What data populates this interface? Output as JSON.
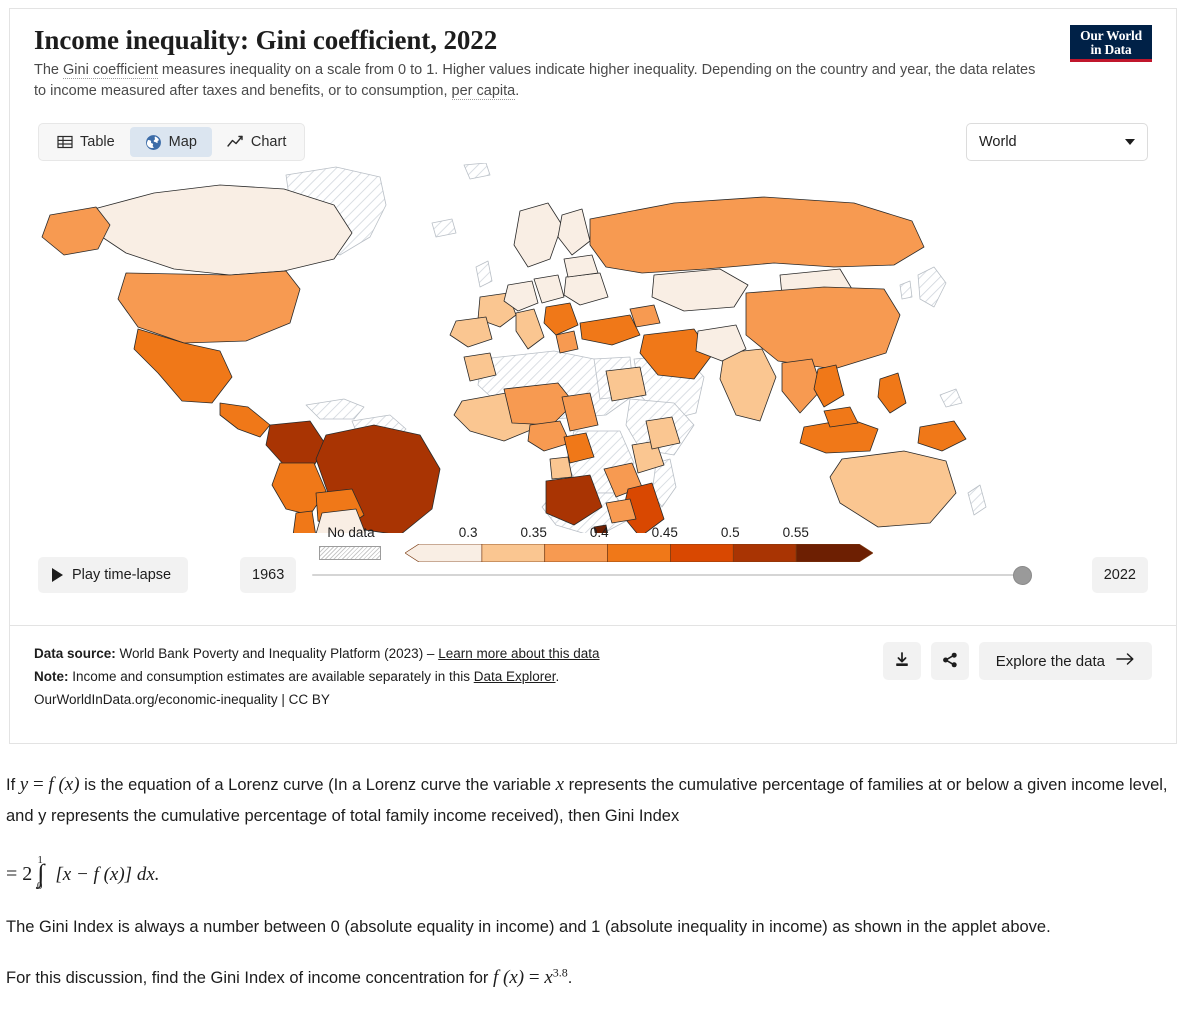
{
  "chart": {
    "title": "Income inequality: Gini coefficient, 2022",
    "subtitle_part1": "The ",
    "subtitle_link1": "Gini coefficient",
    "subtitle_part2": " measures inequality on a scale from 0 to 1. Higher values indicate higher inequality. Depending on the country and year, the data relates to income measured after taxes and benefits, or to consumption, ",
    "subtitle_link2": "per capita",
    "subtitle_part3": ".",
    "logo_line1": "Our World",
    "logo_line2": "in Data"
  },
  "tabs": [
    {
      "label": "Table",
      "icon": "table-icon",
      "active": false
    },
    {
      "label": "Map",
      "icon": "globe-icon",
      "active": true
    },
    {
      "label": "Chart",
      "icon": "line-chart-icon",
      "active": false
    }
  ],
  "entity_select": {
    "value": "World",
    "icon": "chevron-down-icon"
  },
  "legend": {
    "no_data_label": "No data",
    "tick_labels": [
      "0.3",
      "0.35",
      "0.4",
      "0.45",
      "0.5",
      "0.55"
    ],
    "colors": [
      "#f9eee4",
      "#fac691",
      "#f79a51",
      "#f07818",
      "#d94801",
      "#a93403",
      "#6d1f02"
    ]
  },
  "time_controls": {
    "play_label": "Play time-lapse",
    "play_icon": "play-icon",
    "start_year": "1963",
    "end_year": "2022"
  },
  "footer": {
    "source_label": "Data source:",
    "source_text": " World Bank Poverty and Inequality Platform (2023) – ",
    "source_link": "Learn more about this data",
    "note_label": "Note:",
    "note_text": " Income and consumption estimates are available separately in this ",
    "note_link": "Data Explorer",
    "note_tail": ".",
    "license": "OurWorldInData.org/economic-inequality | CC BY",
    "download_icon": "download-icon",
    "share_icon": "share-icon",
    "explore_label": "Explore the data",
    "explore_icon": "arrow-right-icon"
  },
  "prose": {
    "p1_a": "If ",
    "p1_y": "y",
    "p1_eq": " = ",
    "p1_f": "f",
    "p1_fx": " (x)",
    "p1_b": " is the equation of a Lorenz curve (In a Lorenz curve the variable ",
    "p1_x": "x",
    "p1_c": " represents the cumulative percentage of families at or below a given income level, and y represents the cumulative percentage of total family income received), then Gini Index",
    "eq_prefix": "= 2",
    "eq_upper": "1",
    "eq_lower": "0",
    "eq_body": "[x − f (x)] dx.",
    "p2": "The Gini Index is always a number between 0 (absolute equality in income) and 1 (absolute inequality in income) as shown in the applet above.",
    "p3_a": "For this discussion, find the Gini Index of income concentration for ",
    "p3_f": "f (x)",
    "p3_eq": " = ",
    "p3_x": "x",
    "p3_exp": "3.8",
    "p3_end": "."
  },
  "chart_data": {
    "type": "map",
    "title": "Income inequality: Gini coefficient, 2022",
    "metric": "Gini coefficient",
    "year": 2022,
    "projection": "world",
    "legend_bins": [
      {
        "label": "< 0.3",
        "color": "#f9eee4"
      },
      {
        "label": "0.3 – 0.35",
        "color": "#fac691"
      },
      {
        "label": "0.35 – 0.4",
        "color": "#f79a51"
      },
      {
        "label": "0.4 – 0.45",
        "color": "#f07818"
      },
      {
        "label": "0.45 – 0.5",
        "color": "#d94801"
      },
      {
        "label": "0.5 – 0.55",
        "color": "#a93403"
      },
      {
        "label": "> 0.55",
        "color": "#6d1f02"
      }
    ],
    "no_data_color": "hatched",
    "axis_range": [
      0.3,
      0.55
    ],
    "countries": [
      {
        "name": "Canada",
        "bin": 0
      },
      {
        "name": "Alaska",
        "bin": 2
      },
      {
        "name": "United States",
        "bin": 2
      },
      {
        "name": "Mexico",
        "bin": 4
      },
      {
        "name": "Brazil",
        "bin": 5
      },
      {
        "name": "Colombia",
        "bin": 5
      },
      {
        "name": "Peru",
        "bin": 3
      },
      {
        "name": "Bolivia",
        "bin": 3
      },
      {
        "name": "Chile",
        "bin": 3
      },
      {
        "name": "Argentina",
        "bin": 0
      },
      {
        "name": "Greenland",
        "bin": -1
      },
      {
        "name": "Russia",
        "bin": 2
      },
      {
        "name": "China",
        "bin": 2
      },
      {
        "name": "India",
        "bin": 1
      },
      {
        "name": "Kazakhstan",
        "bin": 0
      },
      {
        "name": "Mongolia",
        "bin": 0
      },
      {
        "name": "Turkey",
        "bin": 3
      },
      {
        "name": "Iran",
        "bin": 3
      },
      {
        "name": "Egypt",
        "bin": 1
      },
      {
        "name": "Angola",
        "bin": 5
      },
      {
        "name": "Mozambique",
        "bin": 5
      },
      {
        "name": "Zambia",
        "bin": 4
      },
      {
        "name": "Nigeria",
        "bin": 2
      },
      {
        "name": "Australia",
        "bin": 1
      },
      {
        "name": "Indonesia",
        "bin": 2
      },
      {
        "name": "Malaysia",
        "bin": 3
      },
      {
        "name": "Philippines",
        "bin": 3
      },
      {
        "name": "Papua New Guinea",
        "bin": 3
      },
      {
        "name": "Saudi Arabia",
        "bin": -1
      },
      {
        "name": "Libya",
        "bin": -1
      },
      {
        "name": "Algeria",
        "bin": -1
      }
    ]
  }
}
